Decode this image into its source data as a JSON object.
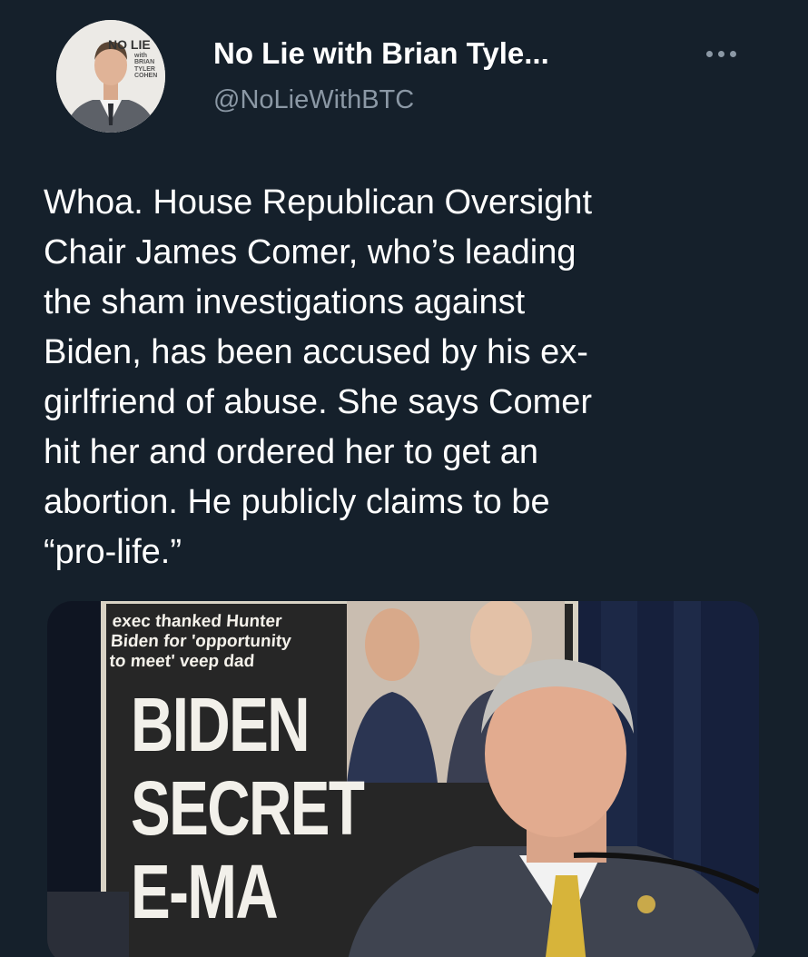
{
  "author": {
    "display_name": "No Lie with Brian Tyle...",
    "handle": "@NoLieWithBTC",
    "avatar_logo": "NO LIE",
    "avatar_logo_sub": "with BRIAN TYLER COHEN"
  },
  "tweet": {
    "text": "Whoa. House Republican Oversight\nChair James Comer, who’s leading\nthe sham investigations against\nBiden, has been accused by his ex-\ngirlfriend of abuse. She says Comer\nhit her and ordered her to get an\nabortion. He publicly claims to be\n“pro-life.”"
  },
  "media": {
    "newspaper_subhead": "exec thanked Hunter\nBiden for 'opportunity\nto meet' veep dad",
    "newspaper_headline": "BIDEN\nSECRET\nE-MA"
  },
  "icons": {
    "more": "more-horizontal-icon"
  },
  "colors": {
    "background": "#15202b",
    "secondary_text": "#8b98a5",
    "primary_text": "#ffffff"
  }
}
